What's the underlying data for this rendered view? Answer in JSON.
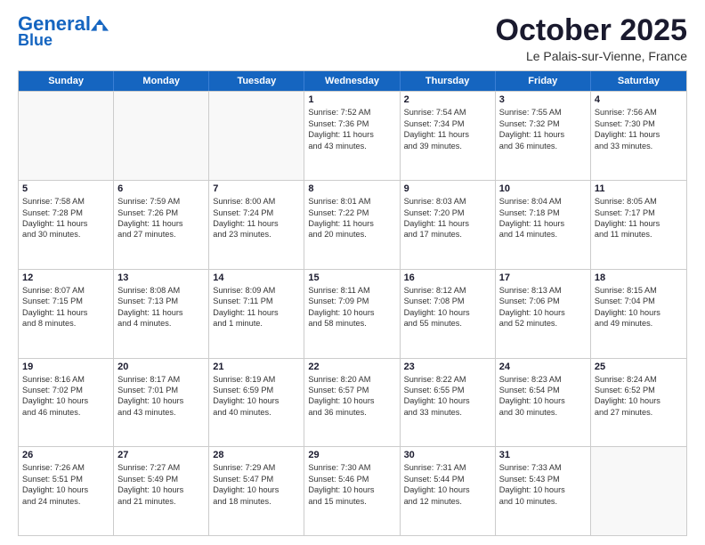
{
  "header": {
    "logo_line1": "General",
    "logo_line2": "Blue",
    "month": "October 2025",
    "location": "Le Palais-sur-Vienne, France"
  },
  "weekdays": [
    "Sunday",
    "Monday",
    "Tuesday",
    "Wednesday",
    "Thursday",
    "Friday",
    "Saturday"
  ],
  "rows": [
    [
      {
        "day": "",
        "lines": [],
        "empty": true
      },
      {
        "day": "",
        "lines": [],
        "empty": true
      },
      {
        "day": "",
        "lines": [],
        "empty": true
      },
      {
        "day": "1",
        "lines": [
          "Sunrise: 7:52 AM",
          "Sunset: 7:36 PM",
          "Daylight: 11 hours",
          "and 43 minutes."
        ]
      },
      {
        "day": "2",
        "lines": [
          "Sunrise: 7:54 AM",
          "Sunset: 7:34 PM",
          "Daylight: 11 hours",
          "and 39 minutes."
        ]
      },
      {
        "day": "3",
        "lines": [
          "Sunrise: 7:55 AM",
          "Sunset: 7:32 PM",
          "Daylight: 11 hours",
          "and 36 minutes."
        ]
      },
      {
        "day": "4",
        "lines": [
          "Sunrise: 7:56 AM",
          "Sunset: 7:30 PM",
          "Daylight: 11 hours",
          "and 33 minutes."
        ]
      }
    ],
    [
      {
        "day": "5",
        "lines": [
          "Sunrise: 7:58 AM",
          "Sunset: 7:28 PM",
          "Daylight: 11 hours",
          "and 30 minutes."
        ]
      },
      {
        "day": "6",
        "lines": [
          "Sunrise: 7:59 AM",
          "Sunset: 7:26 PM",
          "Daylight: 11 hours",
          "and 27 minutes."
        ]
      },
      {
        "day": "7",
        "lines": [
          "Sunrise: 8:00 AM",
          "Sunset: 7:24 PM",
          "Daylight: 11 hours",
          "and 23 minutes."
        ]
      },
      {
        "day": "8",
        "lines": [
          "Sunrise: 8:01 AM",
          "Sunset: 7:22 PM",
          "Daylight: 11 hours",
          "and 20 minutes."
        ]
      },
      {
        "day": "9",
        "lines": [
          "Sunrise: 8:03 AM",
          "Sunset: 7:20 PM",
          "Daylight: 11 hours",
          "and 17 minutes."
        ]
      },
      {
        "day": "10",
        "lines": [
          "Sunrise: 8:04 AM",
          "Sunset: 7:18 PM",
          "Daylight: 11 hours",
          "and 14 minutes."
        ]
      },
      {
        "day": "11",
        "lines": [
          "Sunrise: 8:05 AM",
          "Sunset: 7:17 PM",
          "Daylight: 11 hours",
          "and 11 minutes."
        ]
      }
    ],
    [
      {
        "day": "12",
        "lines": [
          "Sunrise: 8:07 AM",
          "Sunset: 7:15 PM",
          "Daylight: 11 hours",
          "and 8 minutes."
        ]
      },
      {
        "day": "13",
        "lines": [
          "Sunrise: 8:08 AM",
          "Sunset: 7:13 PM",
          "Daylight: 11 hours",
          "and 4 minutes."
        ]
      },
      {
        "day": "14",
        "lines": [
          "Sunrise: 8:09 AM",
          "Sunset: 7:11 PM",
          "Daylight: 11 hours",
          "and 1 minute."
        ]
      },
      {
        "day": "15",
        "lines": [
          "Sunrise: 8:11 AM",
          "Sunset: 7:09 PM",
          "Daylight: 10 hours",
          "and 58 minutes."
        ]
      },
      {
        "day": "16",
        "lines": [
          "Sunrise: 8:12 AM",
          "Sunset: 7:08 PM",
          "Daylight: 10 hours",
          "and 55 minutes."
        ]
      },
      {
        "day": "17",
        "lines": [
          "Sunrise: 8:13 AM",
          "Sunset: 7:06 PM",
          "Daylight: 10 hours",
          "and 52 minutes."
        ]
      },
      {
        "day": "18",
        "lines": [
          "Sunrise: 8:15 AM",
          "Sunset: 7:04 PM",
          "Daylight: 10 hours",
          "and 49 minutes."
        ]
      }
    ],
    [
      {
        "day": "19",
        "lines": [
          "Sunrise: 8:16 AM",
          "Sunset: 7:02 PM",
          "Daylight: 10 hours",
          "and 46 minutes."
        ]
      },
      {
        "day": "20",
        "lines": [
          "Sunrise: 8:17 AM",
          "Sunset: 7:01 PM",
          "Daylight: 10 hours",
          "and 43 minutes."
        ]
      },
      {
        "day": "21",
        "lines": [
          "Sunrise: 8:19 AM",
          "Sunset: 6:59 PM",
          "Daylight: 10 hours",
          "and 40 minutes."
        ]
      },
      {
        "day": "22",
        "lines": [
          "Sunrise: 8:20 AM",
          "Sunset: 6:57 PM",
          "Daylight: 10 hours",
          "and 36 minutes."
        ]
      },
      {
        "day": "23",
        "lines": [
          "Sunrise: 8:22 AM",
          "Sunset: 6:55 PM",
          "Daylight: 10 hours",
          "and 33 minutes."
        ]
      },
      {
        "day": "24",
        "lines": [
          "Sunrise: 8:23 AM",
          "Sunset: 6:54 PM",
          "Daylight: 10 hours",
          "and 30 minutes."
        ]
      },
      {
        "day": "25",
        "lines": [
          "Sunrise: 8:24 AM",
          "Sunset: 6:52 PM",
          "Daylight: 10 hours",
          "and 27 minutes."
        ]
      }
    ],
    [
      {
        "day": "26",
        "lines": [
          "Sunrise: 7:26 AM",
          "Sunset: 5:51 PM",
          "Daylight: 10 hours",
          "and 24 minutes."
        ]
      },
      {
        "day": "27",
        "lines": [
          "Sunrise: 7:27 AM",
          "Sunset: 5:49 PM",
          "Daylight: 10 hours",
          "and 21 minutes."
        ]
      },
      {
        "day": "28",
        "lines": [
          "Sunrise: 7:29 AM",
          "Sunset: 5:47 PM",
          "Daylight: 10 hours",
          "and 18 minutes."
        ]
      },
      {
        "day": "29",
        "lines": [
          "Sunrise: 7:30 AM",
          "Sunset: 5:46 PM",
          "Daylight: 10 hours",
          "and 15 minutes."
        ]
      },
      {
        "day": "30",
        "lines": [
          "Sunrise: 7:31 AM",
          "Sunset: 5:44 PM",
          "Daylight: 10 hours",
          "and 12 minutes."
        ]
      },
      {
        "day": "31",
        "lines": [
          "Sunrise: 7:33 AM",
          "Sunset: 5:43 PM",
          "Daylight: 10 hours",
          "and 10 minutes."
        ]
      },
      {
        "day": "",
        "lines": [],
        "empty": true
      }
    ]
  ]
}
